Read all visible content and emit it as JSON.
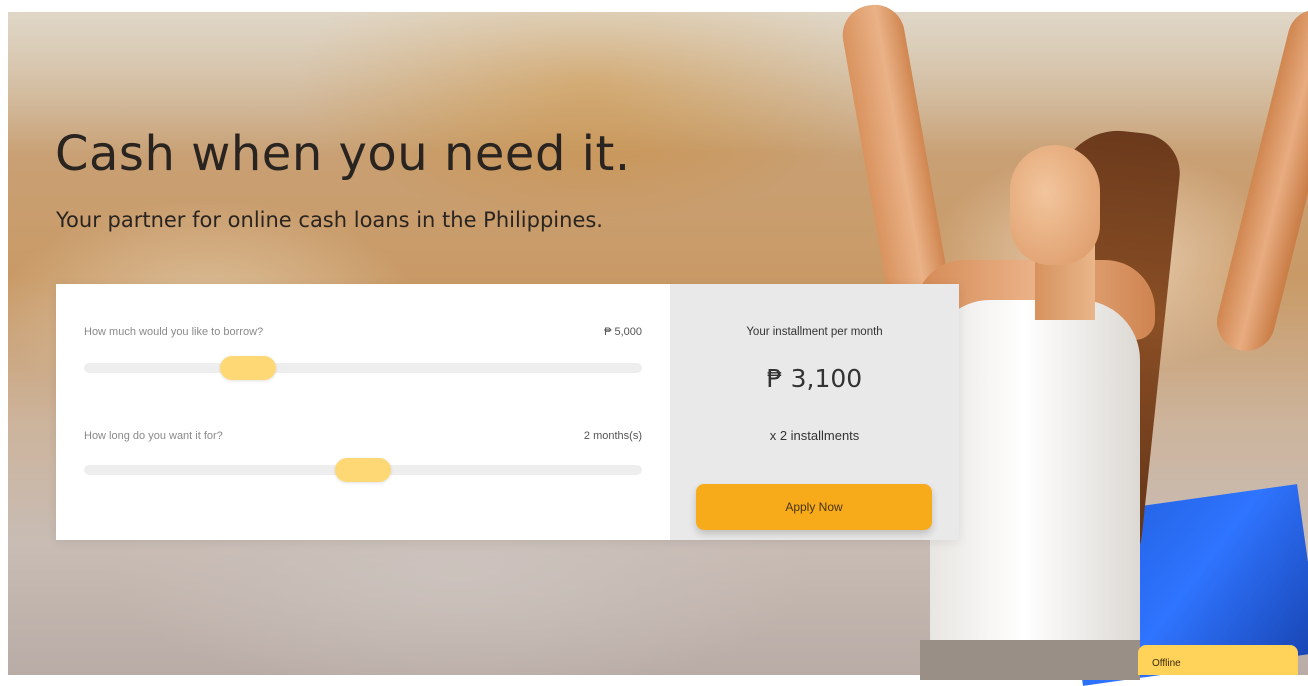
{
  "hero": {
    "title": "Cash when you need it.",
    "subtitle": "Your partner for online cash loans in the Philippines."
  },
  "calculator": {
    "amount": {
      "label": "How much would you like to borrow?",
      "value": "₱ 5,000",
      "slider_fraction": 0.27
    },
    "duration": {
      "label": "How long do you want it for?",
      "value": "2 months(s)",
      "slider_fraction": 0.5
    },
    "summary": {
      "label": "Your installment per month",
      "amount": "₱ 3,100",
      "count": "x 2 installments",
      "apply_label": "Apply Now"
    }
  },
  "chat": {
    "status": "Offline"
  },
  "colors": {
    "accent": "#f7ab1b",
    "slider_thumb": "#ffd876",
    "chat_tab": "#ffd25a"
  }
}
